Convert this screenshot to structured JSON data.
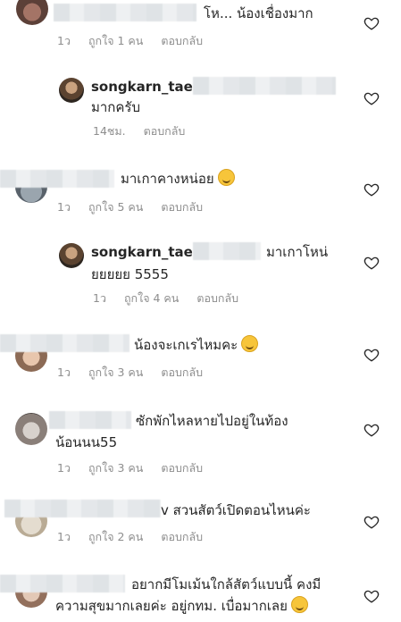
{
  "comments": [
    {
      "text": "โห... น้องเชื่องมาก",
      "time": "1ว",
      "likes": "ถูกใจ 1 คน",
      "reply": "ตอบกลับ"
    },
    {
      "username": "songkarn_tae",
      "text": "มากครับ",
      "time": "14ชม.",
      "reply": "ตอบกลับ"
    },
    {
      "text": "มาเกาคางหน่อย",
      "time": "1ว",
      "likes": "ถูกใจ 5 คน",
      "reply": "ตอบกลับ"
    },
    {
      "username": "songkarn_tae",
      "text_a": "มาเกาโหน่",
      "text_b": "ยยยยย 5555",
      "time": "1ว",
      "likes": "ถูกใจ 4 คน",
      "reply": "ตอบกลับ"
    },
    {
      "text": "น้องจะเกเรไหมคะ",
      "time": "1ว",
      "likes": "ถูกใจ 3 คน",
      "reply": "ตอบกลับ"
    },
    {
      "text_a": "ซักพักไหลหายไปอยู่ในท้อง",
      "text_b": "น้อนนน55",
      "time": "1ว",
      "likes": "ถูกใจ 3 คน",
      "reply": "ตอบกลับ"
    },
    {
      "text": "v สวนสัตว์เปิดตอนไหนค่ะ",
      "time": "1ว",
      "likes": "ถูกใจ 2 คน",
      "reply": "ตอบกลับ"
    },
    {
      "text_a": "อยากมีโมเม้นใกล้สัตว์แบบนี้ คงมี",
      "text_b": "ความสุขมากเลยค่ะ อยู่กทม. เบื่อมากเลย"
    }
  ],
  "icons": {
    "heart": "heart-outline-icon",
    "emoji": "smiling-face-emoji"
  },
  "colors": {
    "text": "#262626",
    "meta": "#8e8e8e",
    "heart": "#262626"
  }
}
